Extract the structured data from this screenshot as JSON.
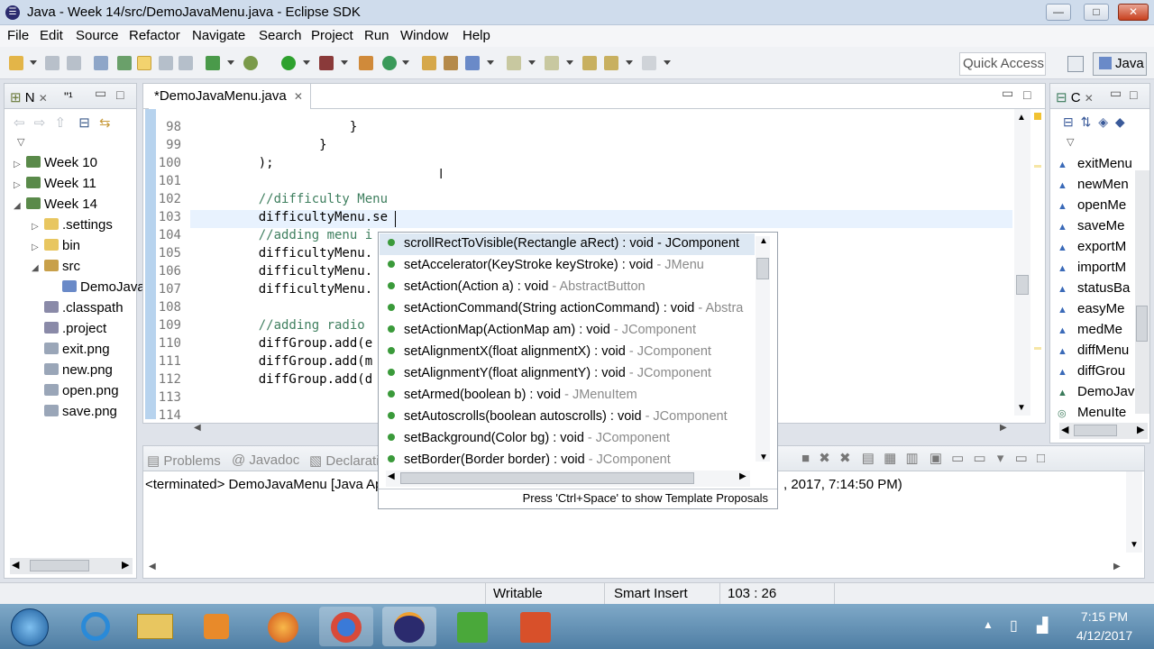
{
  "window": {
    "title": "Java - Week 14/src/DemoJavaMenu.java - Eclipse SDK",
    "minimize": "—",
    "maximize": "□",
    "close": "✕"
  },
  "menu": [
    "File",
    "Edit",
    "Source",
    "Refactor",
    "Navigate",
    "Search",
    "Project",
    "Run",
    "Window",
    "Help"
  ],
  "quick_access": "Quick Access",
  "perspective": "Java",
  "left_panel": {
    "tab1": "N",
    "tab2": "\"¹",
    "tree": [
      {
        "label": "Week 10",
        "level": 0,
        "icon": "project",
        "arrow": "▷"
      },
      {
        "label": "Week 11",
        "level": 0,
        "icon": "project",
        "arrow": "▷"
      },
      {
        "label": "Week 14",
        "level": 0,
        "icon": "project",
        "arrow": "◢"
      },
      {
        "label": ".settings",
        "level": 1,
        "icon": "folder",
        "arrow": "▷"
      },
      {
        "label": "bin",
        "level": 1,
        "icon": "folder",
        "arrow": "▷"
      },
      {
        "label": "src",
        "level": 1,
        "icon": "package",
        "arrow": "◢"
      },
      {
        "label": "DemoJava",
        "level": 2,
        "icon": "java-file",
        "arrow": ""
      },
      {
        "label": ".classpath",
        "level": 1,
        "icon": "xml-file",
        "arrow": ""
      },
      {
        "label": ".project",
        "level": 1,
        "icon": "xml-file",
        "arrow": ""
      },
      {
        "label": "exit.png",
        "level": 1,
        "icon": "image-file",
        "arrow": ""
      },
      {
        "label": "new.png",
        "level": 1,
        "icon": "image-file",
        "arrow": ""
      },
      {
        "label": "open.png",
        "level": 1,
        "icon": "image-file",
        "arrow": ""
      },
      {
        "label": "save.png",
        "level": 1,
        "icon": "image-file",
        "arrow": ""
      }
    ]
  },
  "editor": {
    "tab": "*DemoJavaMenu.java",
    "lines": [
      {
        "n": "98",
        "text": "                }",
        "comment": false
      },
      {
        "n": "99",
        "text": "            }",
        "comment": false
      },
      {
        "n": "100",
        "text": "    );",
        "comment": false
      },
      {
        "n": "101",
        "text": "",
        "comment": false
      },
      {
        "n": "102",
        "text": "    //difficulty Menu",
        "comment": true
      },
      {
        "n": "103",
        "text": "    difficultyMenu.se",
        "comment": false
      },
      {
        "n": "104",
        "text": "    //adding menu i",
        "comment": true
      },
      {
        "n": "105",
        "text": "    difficultyMenu.",
        "comment": false
      },
      {
        "n": "106",
        "text": "    difficultyMenu.",
        "comment": false
      },
      {
        "n": "107",
        "text": "    difficultyMenu.",
        "comment": false
      },
      {
        "n": "108",
        "text": "",
        "comment": false
      },
      {
        "n": "109",
        "text": "    //adding radio",
        "comment": true
      },
      {
        "n": "110",
        "text": "    diffGroup.add(e",
        "comment": false
      },
      {
        "n": "111",
        "text": "    diffGroup.add(m",
        "comment": false
      },
      {
        "n": "112",
        "text": "    diffGroup.add(d",
        "comment": false
      },
      {
        "n": "113",
        "text": "",
        "comment": false
      },
      {
        "n": "114",
        "text": "",
        "comment": false
      }
    ]
  },
  "autocomplete": {
    "items": [
      {
        "main": "scrollRectToVisible(Rectangle aRect) : void - JComponent",
        "type": ""
      },
      {
        "main": "setAccelerator(KeyStroke keyStroke) : void",
        "type": " - JMenu"
      },
      {
        "main": "setAction(Action a) : void",
        "type": " - AbstractButton"
      },
      {
        "main": "setActionCommand(String actionCommand) : void",
        "type": " - Abstra"
      },
      {
        "main": "setActionMap(ActionMap am) : void",
        "type": " - JComponent"
      },
      {
        "main": "setAlignmentX(float alignmentX) : void",
        "type": " - JComponent"
      },
      {
        "main": "setAlignmentY(float alignmentY) : void",
        "type": " - JComponent"
      },
      {
        "main": "setArmed(boolean b) : void",
        "type": " - JMenuItem"
      },
      {
        "main": "setAutoscrolls(boolean autoscrolls) : void",
        "type": " - JComponent"
      },
      {
        "main": "setBackground(Color bg) : void",
        "type": " - JComponent"
      },
      {
        "main": "setBorder(Border border) : void",
        "type": " - JComponent"
      }
    ],
    "hint": "Press 'Ctrl+Space' to show Template Proposals"
  },
  "outline": {
    "tab": "C",
    "items": [
      "exitMenu",
      "newMen",
      "openMe",
      "saveMe",
      "exportM",
      "importM",
      "statusBa",
      "easyMe",
      "medMe",
      "diffMenu",
      "diffGrou",
      "DemoJav",
      "MenuIte"
    ]
  },
  "bottom": {
    "tabs": [
      "Problems",
      "@ Javadoc",
      "Declaratio"
    ],
    "console_left": "<terminated> DemoJavaMenu [Java Ap",
    "console_right": ", 2017, 7:14:50 PM)"
  },
  "status": {
    "writable": "Writable",
    "insert": "Smart Insert",
    "position": "103 : 26"
  },
  "taskbar": {
    "time": "7:15 PM",
    "date": "4/12/2017"
  },
  "colors": {
    "comment": "#3f7f5f",
    "selection": "#dde8f3"
  }
}
